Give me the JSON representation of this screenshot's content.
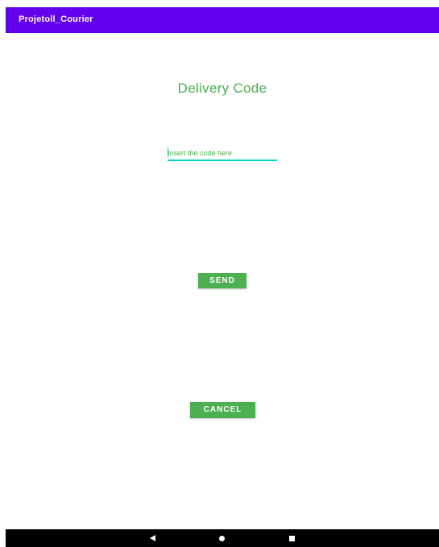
{
  "app_bar": {
    "title": "Projetoll_Courier",
    "color": "#6200ee"
  },
  "main": {
    "heading": "Delivery Code",
    "code_input": {
      "value": "",
      "placeholder": "Insert the code here"
    },
    "send_label": "SEND",
    "cancel_label": "CANCEL",
    "accent_color": "#4caf50",
    "underline_color": "#03dac5"
  },
  "nav_bar": {
    "back_icon": "back-triangle-icon",
    "home_icon": "home-circle-icon",
    "recents_icon": "recents-square-icon"
  }
}
